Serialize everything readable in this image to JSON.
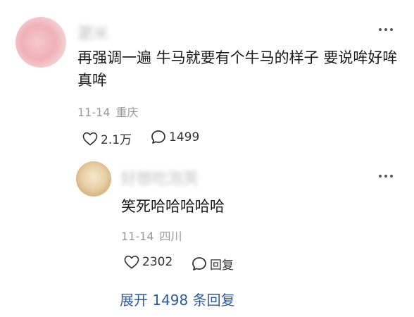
{
  "comment": {
    "username": "淝米",
    "text": "再强调一遍 牛马就要有个牛马的样子 要说哞好哞 真哞",
    "date": "11-14",
    "location": "重庆",
    "likes": "2.1万",
    "comments": "1499"
  },
  "reply": {
    "username": "好想吃泡芙",
    "text": "笑死哈哈哈哈哈",
    "date": "11-14",
    "location": "四川",
    "likes": "2302",
    "reply_label": "回复"
  },
  "expand_label": "展开 1498 条回复",
  "colors": {
    "text": "#1a1a1a",
    "meta": "#999999",
    "link": "#2e5a9b"
  },
  "icons": [
    "avatar",
    "more-icon",
    "heart-icon",
    "comment-icon"
  ]
}
